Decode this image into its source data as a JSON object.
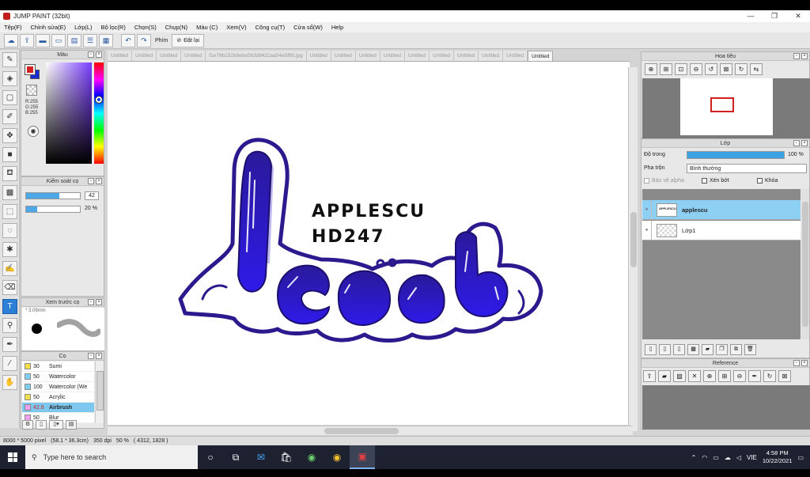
{
  "window": {
    "title": "JUMP PAINT (32bit)",
    "controls": [
      "—",
      "❐",
      "✕"
    ]
  },
  "menu": [
    "Tệp(F)",
    "Chỉnh sửa(E)",
    "Lớp(L)",
    "Bộ lọc(R)",
    "Chọn(S)",
    "Chụp(N)",
    "Màu (C)",
    "Xem(V)",
    "Công cụ(T)",
    "Cửa sổ(W)",
    "Help"
  ],
  "toolbar": {
    "key_label": "Phím",
    "reset_label": "Đặt lại"
  },
  "color_panel": {
    "title": "Màu",
    "rgb": [
      "R:255",
      "G:255",
      "B:255"
    ],
    "fg_color": "#d02020",
    "bg_color": "#1a2bd6"
  },
  "brush_control": {
    "title": "Kiểm soát cọ",
    "size_value": "42",
    "opacity_value": "20 %",
    "size_fraction": 0.62,
    "opacity_fraction": 0.2
  },
  "brush_preview": {
    "title": "Xem trước cọ",
    "size_text": "* 3.09mm"
  },
  "brush_list": {
    "title": "Cọ",
    "items": [
      {
        "size": "30",
        "name": "Sumi",
        "color": "#f4e04a"
      },
      {
        "size": "50",
        "name": "Watercolor",
        "color": "#7ed0f0"
      },
      {
        "size": "100",
        "name": "Watercolor (We",
        "color": "#7ed0f0"
      },
      {
        "size": "50",
        "name": "Acrylic",
        "color": "#f4e04a"
      },
      {
        "size": "42.6",
        "name": "Airbrush",
        "color": "#f0a0f0",
        "selected": true
      },
      {
        "size": "50",
        "name": "Blur",
        "color": "#f0a0f0"
      }
    ]
  },
  "doc_tabs": [
    "Untitled",
    "Untitled",
    "Untitled",
    "Untitled",
    "f1e79b152b8ebe5fcfd9432aa04e5f95.jpg",
    "Untitled",
    "Untitled",
    "Untitled",
    "Untitled",
    "Untitled",
    "Untitled",
    "Untitled",
    "Untitled",
    "Untitled",
    "Untitled"
  ],
  "canvas": {
    "line1": "APPLESCU",
    "line2": "HD247"
  },
  "navigator": {
    "title": "Hoa tiêu"
  },
  "layer_panel": {
    "title": "Lớp",
    "opacity_label": "Độ trong",
    "opacity_value": "100 %",
    "blend_label": "Pha trộn",
    "blend_value": "Bình thường",
    "protect_alpha": "Bảo vệ alpha",
    "clip": "Xén bớt",
    "lock": "Khóa",
    "layers": [
      {
        "name": "applescu",
        "selected": true
      },
      {
        "name": "Lớp1",
        "selected": false
      }
    ]
  },
  "reference": {
    "title": "Reference"
  },
  "status": {
    "size": "8000 * 5000 pixel",
    "cm": "(58.1 * 36.3cm)",
    "dpi": "350 dpi",
    "zoom": "50 %",
    "cursor": "( 4312, 1828 )"
  },
  "taskbar": {
    "search_placeholder": "Type here to search",
    "lang": "VIE",
    "time": "4:58 PM",
    "date": "10/22/2021"
  }
}
